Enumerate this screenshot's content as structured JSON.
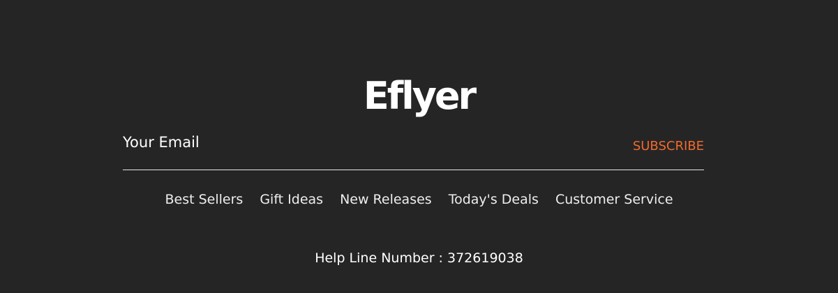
{
  "footer": {
    "logo_text": "Eflyer",
    "newsletter": {
      "email_placeholder": "Your Email",
      "subscribe_label": "SUBSCRIBE"
    },
    "nav": [
      {
        "label": "Best Sellers"
      },
      {
        "label": "Gift Ideas"
      },
      {
        "label": "New Releases"
      },
      {
        "label": "Today's Deals"
      },
      {
        "label": "Customer Service"
      }
    ],
    "helpline": "Help Line Number : 372619038"
  },
  "colors": {
    "background": "#252525",
    "accent": "#f06a2e",
    "text": "#ffffff"
  }
}
